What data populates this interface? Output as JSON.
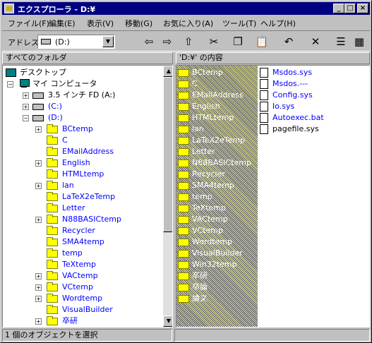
{
  "window": {
    "title": "エクスプローラ - D:¥",
    "minimize": "_",
    "maximize": "□",
    "close": "×"
  },
  "menu": [
    "ファイル(F)",
    "編集(E)",
    "表示(V)",
    "移動(G)",
    "お気に入り(A)",
    "ツール(T)",
    "ヘルプ(H)"
  ],
  "address": {
    "label": "アドレス",
    "value": "(D:)"
  },
  "toolbar_icons": [
    "back-icon",
    "forward-icon",
    "up-folder-icon",
    "cut-icon",
    "copy-icon",
    "paste-icon",
    "undo-icon",
    "delete-icon",
    "properties-icon"
  ],
  "tree_header": "すべてのフォルダ",
  "list_header": "'D:¥' の内容",
  "tree": {
    "desktop": "デスクトップ",
    "mycomputer": "マイ コンピュータ",
    "floppy": "3.5 インチ FD (A:)",
    "drive_c": "(C:)",
    "drive_d": "(D:)",
    "folders": [
      "BCtemp",
      "C",
      "EMailAddress",
      "English",
      "HTMLtemp",
      "lan",
      "LaTeX2eTemp",
      "Letter",
      "N88BASICtemp",
      "Recycler",
      "SMA4temp",
      "temp",
      "TeXtemp",
      "VACtemp",
      "VCtemp",
      "Wordtemp",
      "VisualBuilder",
      "卒研"
    ],
    "expanded_flags": [
      true,
      false,
      false,
      true,
      false,
      true,
      false,
      false,
      true,
      false,
      false,
      false,
      false,
      true,
      true,
      true,
      false,
      true
    ]
  },
  "list": {
    "folders": [
      "BCtemp",
      "C",
      "EMailAddress",
      "English",
      "HTMLtemp",
      "lan",
      "LaTeX2eTemp",
      "Letter",
      "N88BASICtemp",
      "Recycler",
      "SMA4temp",
      "temp",
      "TeXtemp",
      "VACtemp",
      "VCtemp",
      "Wordtemp",
      "VisualBuilder",
      "Win32temp",
      "卒研",
      "卒論",
      "論文"
    ],
    "files": [
      "Msdos.sys",
      "Msdos.---",
      "Config.sys",
      "Io.sys",
      "Autoexec.bat",
      "pagefile.sys"
    ]
  },
  "status": {
    "text": "1 個のオブジェクトを選択"
  }
}
